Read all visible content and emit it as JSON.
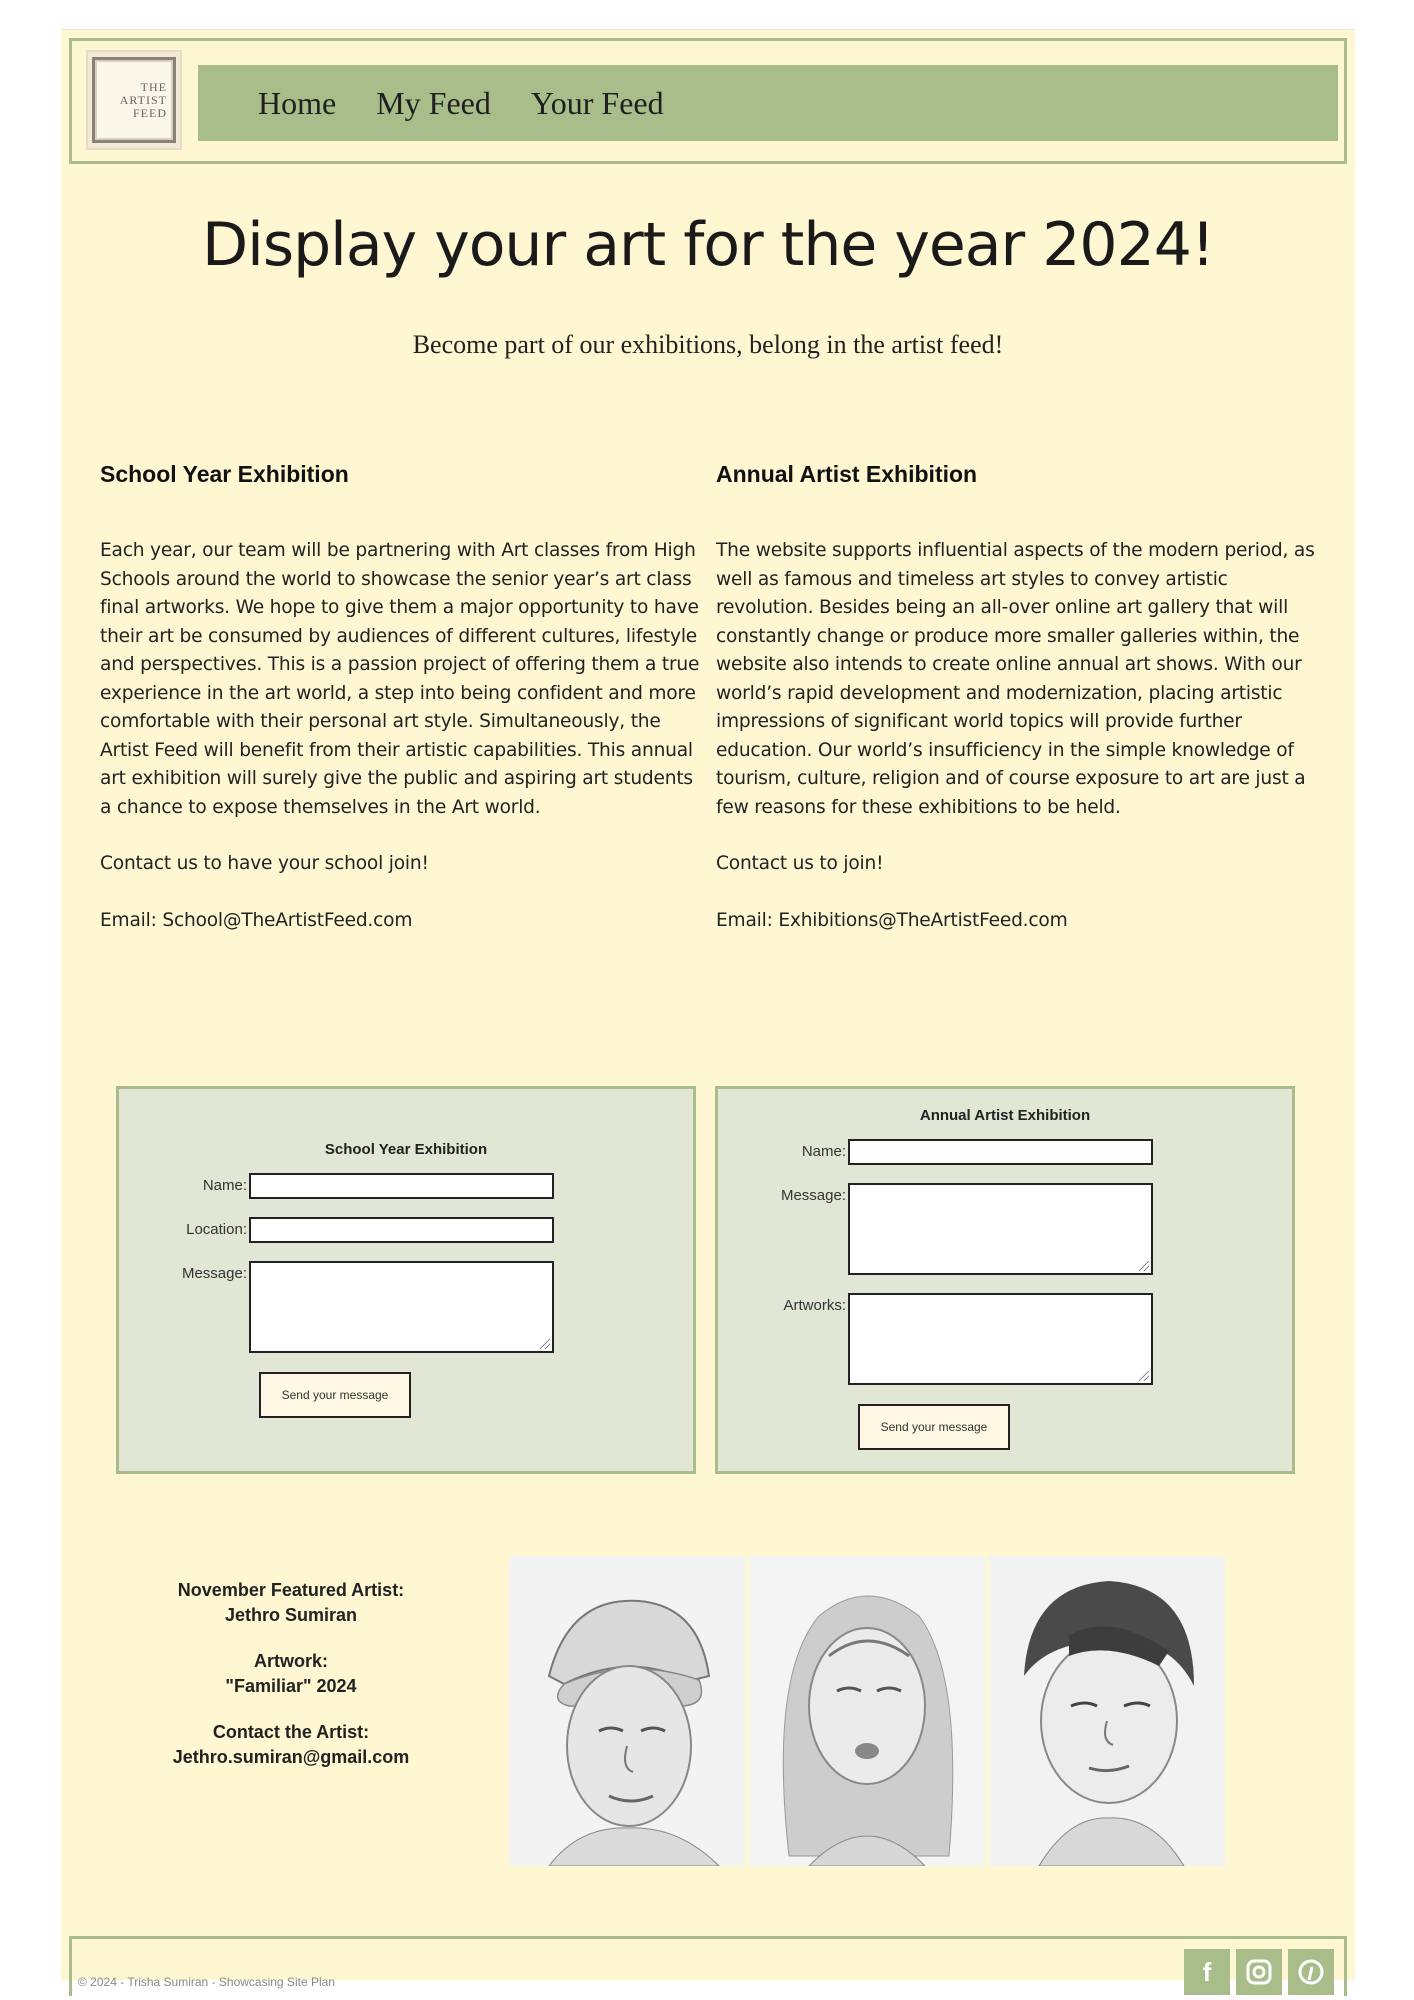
{
  "logo": {
    "line1": "THE",
    "line2": "ARTIST",
    "line3": "FEED"
  },
  "nav": {
    "items": [
      "Home",
      "My Feed",
      "Your Feed"
    ]
  },
  "hero": {
    "title": "Display your art for the year 2024!",
    "subtitle": "Become part of our exhibitions, belong in the artist feed!"
  },
  "school": {
    "heading": "School Year Exhibition",
    "body": "Each year, our team will be partnering with Art classes from High Schools around the world to showcase the senior year’s art class final artworks. We hope to give them a major opportunity to have their art be consumed by audiences of different cultures, lifestyle and perspectives. This is a passion project of offering them a true experience in the art world, a step into being confident and more comfortable with their personal art style. Simultaneously, the Artist Feed will benefit from their artistic capabilities. This annual art exhibition will surely give the public and aspiring art students a chance to expose themselves in the Art world.",
    "contact": "Contact us to have your school join!",
    "email": "Email: School@TheArtistFeed.com"
  },
  "annual": {
    "heading": "Annual Artist Exhibition",
    "body": "The website supports influential aspects of the modern period, as well as famous and timeless art styles to convey artistic revolution. Besides being an all-over online art gallery that will constantly change or produce more smaller galleries within, the website also intends to create online annual art shows. With our world’s rapid development and modernization, placing artistic impressions of significant world topics will provide further education. Our world’s insufficiency in the simple knowledge of tourism, culture, religion and of course exposure to art are just a few reasons for these exhibitions to be held.",
    "contact": "Contact us to join!",
    "email": "Email: Exhibitions@TheArtistFeed.com"
  },
  "form_school": {
    "title": "School Year Exhibition",
    "name_label": "Name:",
    "location_label": "Location:",
    "message_label": "Message:",
    "button": "Send your message"
  },
  "form_annual": {
    "title": "Annual Artist Exhibition",
    "name_label": "Name:",
    "message_label": "Message:",
    "artworks_label": "Artworks:",
    "button": "Send your message"
  },
  "featured": {
    "line1": "November Featured Artist:",
    "line2": "Jethro Sumiran",
    "line3": "Artwork:",
    "line4": "\"Familiar\" 2024",
    "line5": "Contact the Artist:",
    "line6": "Jethro.sumiran@gmail.com"
  },
  "footer": {
    "text": "© 2024 - Trisha Sumiran - Showcasing Site Plan"
  },
  "socials": [
    "facebook-icon",
    "instagram-icon",
    "pinterest-icon"
  ],
  "colors": {
    "background": "#fff6d2",
    "accent": "#a9bd8a",
    "form_bg": "#e1e6d5"
  }
}
